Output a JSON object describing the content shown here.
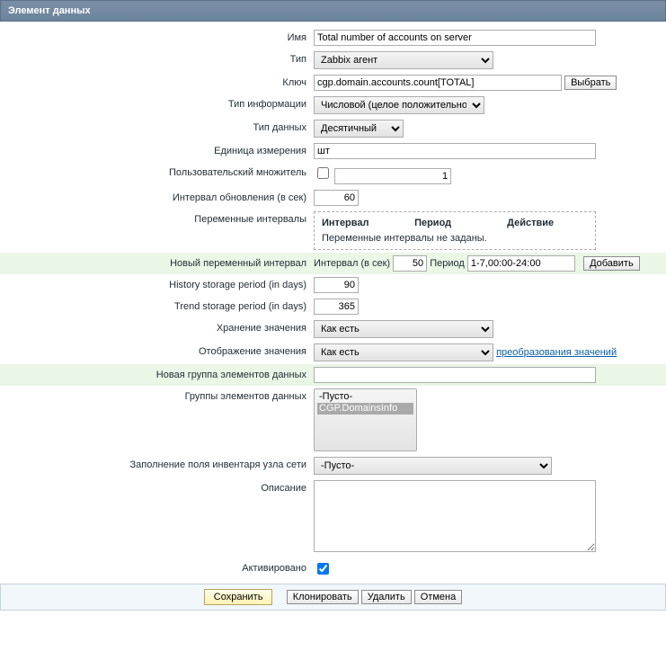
{
  "header": "Элемент данных",
  "labels": {
    "name": "Имя",
    "type": "Тип",
    "key": "Ключ",
    "info_type": "Тип информации",
    "data_type": "Тип данных",
    "units": "Единица измерения",
    "multiplier": "Пользовательский множитель",
    "update_interval": "Интервал обновления (в сек)",
    "flex_intervals": "Переменные интервалы",
    "new_flex": "Новый переменный интервал",
    "history": "History storage period (in days)",
    "trends": "Trend storage period (in days)",
    "store_value": "Хранение значения",
    "show_value": "Отображение значения",
    "new_app": "Новая группа элементов данных",
    "apps": "Группы элементов данных",
    "inventory": "Заполнение поля инвентаря узла сети",
    "description": "Описание",
    "status": "Активировано"
  },
  "values": {
    "name": "Total number of accounts on server",
    "type": "Zabbix агент",
    "key": "cgp.domain.accounts.count[TOTAL]",
    "info_type": "Числовой (целое положительное)",
    "data_type": "Десятичный",
    "units": "шт",
    "multiplier": "1",
    "update_interval": "60",
    "new_flex_interval": "50",
    "new_flex_period": "1-7,00:00-24:00",
    "history": "90",
    "trends": "365",
    "store_value": "Как есть",
    "show_value": "Как есть",
    "inventory": "-Пусто-",
    "apps_none": "-Пусто-",
    "apps_selected": "CGP.DomainsInfo"
  },
  "buttons": {
    "select_key": "Выбрать",
    "add_flex": "Добавить",
    "show_value_link": "преобразования значений",
    "save": "Сохранить",
    "clone": "Клонировать",
    "delete": "Удалить",
    "cancel": "Отмена"
  },
  "flex_box": {
    "col_interval": "Интервал",
    "col_period": "Период",
    "col_action": "Действие",
    "none_msg": "Переменные интервалы не заданы."
  },
  "flex_labels": {
    "interval": "Интервал (в сек)",
    "period": "Период"
  }
}
